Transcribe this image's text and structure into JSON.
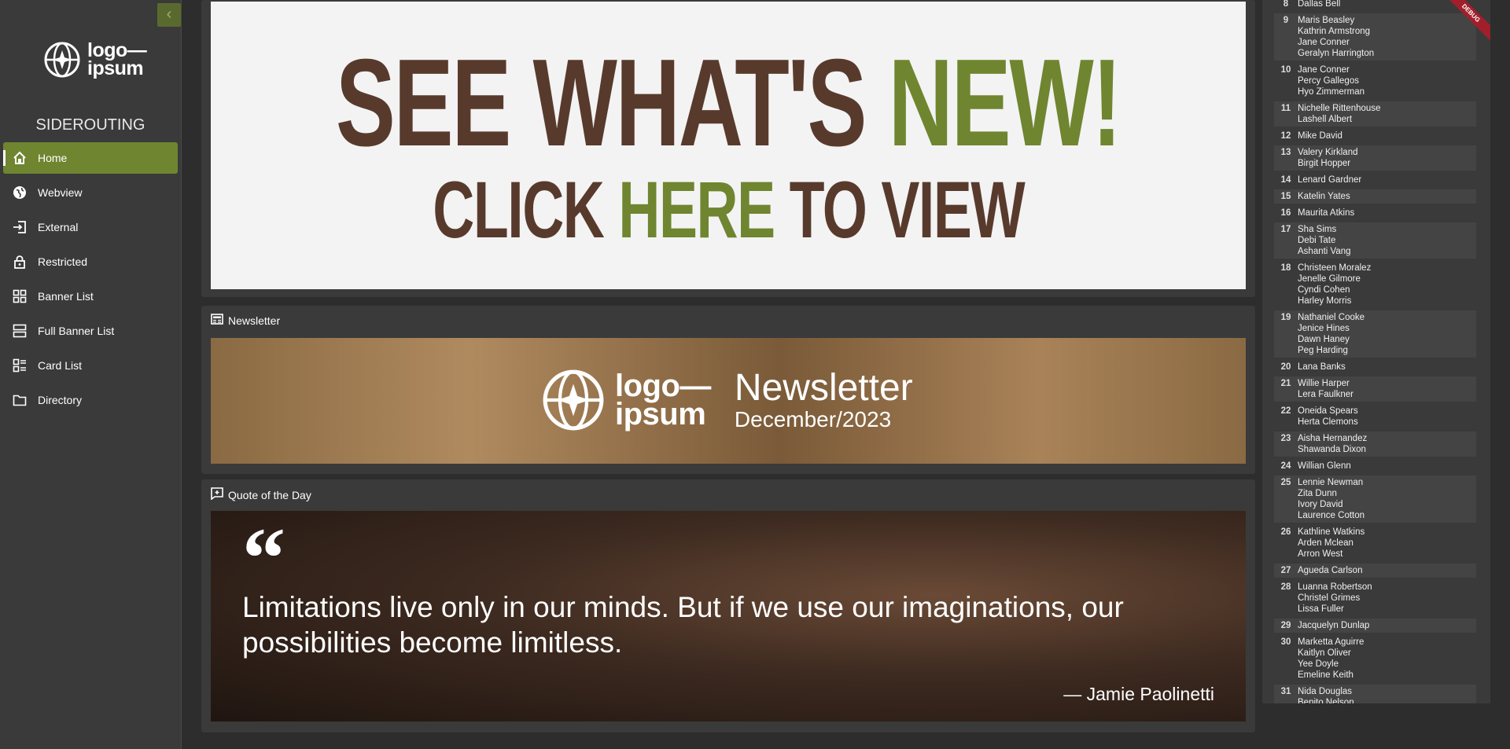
{
  "sidebar": {
    "logo_line1": "logo—",
    "logo_line2": "ipsum",
    "app_title": "SIDEROUTING",
    "items": [
      {
        "label": "Home",
        "icon": "home-icon",
        "active": true
      },
      {
        "label": "Webview",
        "icon": "globe-icon",
        "active": false
      },
      {
        "label": "External",
        "icon": "sign-in-icon",
        "active": false
      },
      {
        "label": "Restricted",
        "icon": "lock-icon",
        "active": false
      },
      {
        "label": "Banner List",
        "icon": "grid-icon",
        "active": false
      },
      {
        "label": "Full Banner List",
        "icon": "list-icon",
        "active": false
      },
      {
        "label": "Card List",
        "icon": "cards-icon",
        "active": false
      },
      {
        "label": "Directory",
        "icon": "folder-icon",
        "active": false
      }
    ]
  },
  "hero": {
    "line1_a": "SEE WHAT'S ",
    "line1_b": "NEW!",
    "line2_a": "CLICK ",
    "line2_b": "HERE",
    "line2_c": " TO VIEW"
  },
  "newsletter": {
    "section_title": "Newsletter",
    "banner_title": "Newsletter",
    "banner_date": "December/2023",
    "logo_line1": "logo—",
    "logo_line2": "ipsum"
  },
  "quote": {
    "section_title": "Quote of the Day",
    "text": "Limitations live only in our minds.  But if we use our imaginations, our possibilities become limitless.",
    "author": "— Jamie Paolinetti"
  },
  "birthdays": [
    {
      "day": "8",
      "names": [
        "Dallas Bell"
      ]
    },
    {
      "day": "9",
      "names": [
        "Maris Beasley",
        "Kathrin Armstrong",
        "Jane Conner",
        "Geralyn Harrington"
      ]
    },
    {
      "day": "10",
      "names": [
        "Jane Conner",
        "Percy Gallegos",
        "Hyo Zimmerman"
      ]
    },
    {
      "day": "11",
      "names": [
        "Nichelle Rittenhouse",
        "Lashell Albert"
      ]
    },
    {
      "day": "12",
      "names": [
        "Mike David"
      ]
    },
    {
      "day": "13",
      "names": [
        "Valery Kirkland",
        "Birgit Hopper"
      ]
    },
    {
      "day": "14",
      "names": [
        "Lenard Gardner"
      ]
    },
    {
      "day": "15",
      "names": [
        "Katelin Yates"
      ]
    },
    {
      "day": "16",
      "names": [
        "Maurita Atkins"
      ]
    },
    {
      "day": "17",
      "names": [
        "Sha Sims",
        "Debi Tate",
        "Ashanti Vang"
      ]
    },
    {
      "day": "18",
      "names": [
        "Christeen Moralez",
        "Jenelle Gilmore",
        "Cyndi Cohen",
        "Harley Morris"
      ]
    },
    {
      "day": "19",
      "names": [
        "Nathaniel Cooke",
        "Jenice Hines",
        "Dawn Haney",
        "Peg Harding"
      ]
    },
    {
      "day": "20",
      "names": [
        "Lana Banks"
      ]
    },
    {
      "day": "21",
      "names": [
        "Willie Harper",
        "Lera Faulkner"
      ]
    },
    {
      "day": "22",
      "names": [
        "Oneida Spears",
        "Herta Clemons"
      ]
    },
    {
      "day": "23",
      "names": [
        "Aisha Hernandez",
        "Shawanda Dixon"
      ]
    },
    {
      "day": "24",
      "names": [
        "Willian Glenn"
      ]
    },
    {
      "day": "25",
      "names": [
        "Lennie Newman",
        "Zita Dunn",
        "Ivory David",
        "Laurence Cotton"
      ]
    },
    {
      "day": "26",
      "names": [
        "Kathline Watkins",
        "Arden Mclean",
        "Arron West"
      ]
    },
    {
      "day": "27",
      "names": [
        "Agueda Carlson"
      ]
    },
    {
      "day": "28",
      "names": [
        "Luanna Robertson",
        "Christel Grimes",
        "Lissa Fuller"
      ]
    },
    {
      "day": "29",
      "names": [
        "Jacquelyn Dunlap"
      ]
    },
    {
      "day": "30",
      "names": [
        "Marketta Aguirre",
        "Kaitlyn Oliver",
        "Yee Doyle",
        "Emeline Keith"
      ]
    },
    {
      "day": "31",
      "names": [
        "Nida Douglas",
        "Benito Nelson"
      ]
    }
  ],
  "debug_label": "DEBUG",
  "colors": {
    "accent": "#6f8530",
    "hero_brown": "#583a2d",
    "bg": "#2d2d2d",
    "panel": "#3a3a3a"
  }
}
